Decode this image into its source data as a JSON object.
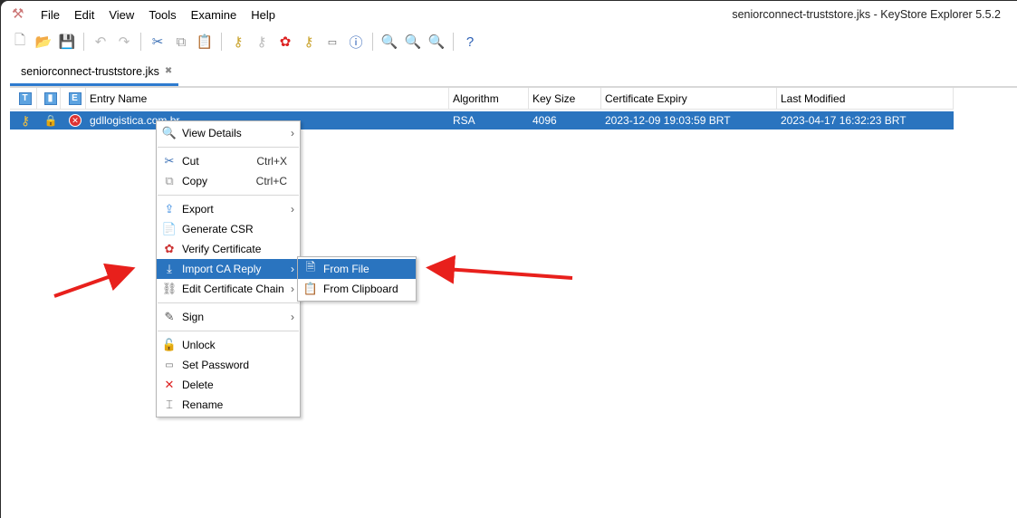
{
  "window": {
    "title": "seniorconnect-truststore.jks - KeyStore Explorer 5.5.2"
  },
  "menubar": [
    "File",
    "Edit",
    "View",
    "Tools",
    "Examine",
    "Help"
  ],
  "toolbar": [
    "new-icon",
    "open-icon",
    "save-icon",
    "undo-icon",
    "redo-icon",
    "cut-icon",
    "copy-icon",
    "paste-icon",
    "generate-keypair-icon",
    "generate-secret-key-icon",
    "import-trusted-cert-icon",
    "import-keypair-icon",
    "set-password-icon",
    "properties-icon",
    "examine-file-icon",
    "examine-clipboard-icon",
    "examine-ssl-icon",
    "help-icon"
  ],
  "tab": {
    "label": "seniorconnect-truststore.jks"
  },
  "table": {
    "headers": {
      "t": "T",
      "lock": "",
      "e": "E",
      "name": "Entry Name",
      "algorithm": "Algorithm",
      "key_size": "Key Size",
      "expiry": "Certificate Expiry",
      "modified": "Last Modified"
    },
    "rows": [
      {
        "name": "gdllogistica.com.br",
        "algorithm": "RSA",
        "key_size": "4096",
        "expiry": "2023-12-09 19:03:59 BRT",
        "modified": "2023-04-17 16:32:23 BRT"
      }
    ]
  },
  "context_menu": {
    "view_details": "View Details",
    "cut": "Cut",
    "cut_sc": "Ctrl+X",
    "copy": "Copy",
    "copy_sc": "Ctrl+C",
    "export": "Export",
    "generate_csr": "Generate CSR",
    "verify": "Verify Certificate",
    "import_ca": "Import CA Reply",
    "edit_chain": "Edit Certificate Chain",
    "sign": "Sign",
    "unlock": "Unlock",
    "set_password": "Set Password",
    "delete": "Delete",
    "rename": "Rename"
  },
  "submenu": {
    "from_file": "From File",
    "from_clipboard": "From Clipboard"
  },
  "colors": {
    "selection": "#2a74bf",
    "annotation": "#e8201c"
  }
}
